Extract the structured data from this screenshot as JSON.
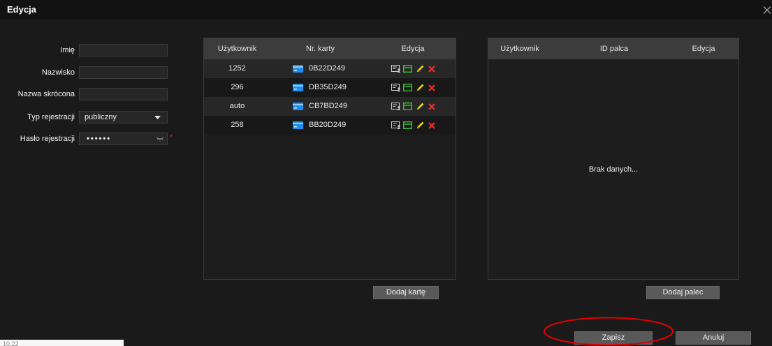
{
  "dialog": {
    "title": "Edycja"
  },
  "form": {
    "fields": [
      {
        "label": "Imię",
        "value": ""
      },
      {
        "label": "Nazwisko",
        "value": ""
      },
      {
        "label": "Nazwa skrócona",
        "value": ""
      },
      {
        "label": "Typ rejestracji",
        "value": "publiczny"
      },
      {
        "label": "Hasło rejestracji",
        "value": "••••••"
      }
    ],
    "required_mark": "*"
  },
  "cards_table": {
    "headers": [
      "Użytkownik",
      "Nr. karty",
      "Edycja"
    ],
    "rows": [
      {
        "user": "1252",
        "card": "0B22D249"
      },
      {
        "user": "296",
        "card": "DB35D249"
      },
      {
        "user": "auto",
        "card": "CB7BD249"
      },
      {
        "user": "258",
        "card": "BB20D249"
      }
    ],
    "add_button": "Dodaj kartę"
  },
  "fingerprint_table": {
    "headers": [
      "Użytkownik",
      "ID palca",
      "Edycja"
    ],
    "empty_text": "Brak danych...",
    "add_button": "Dodaj palec"
  },
  "footer": {
    "save_label": "Zapisz",
    "cancel_label": "Anuluj"
  },
  "status_strip": {
    "text": "10.22"
  },
  "icons": {
    "close": "close-icon",
    "select_arrow": "chevron-down-icon",
    "password_toggle": "eye-closed-icon",
    "card": "card-icon",
    "row_actions": [
      "card-info-icon",
      "card-status-icon",
      "pencil-icon",
      "delete-icon"
    ]
  },
  "colors": {
    "background": "#1a1a1a",
    "table_header": "#3c3c3c",
    "button": "#595959",
    "card_blue": "#1f8ef1",
    "action_green": "#3cc13c",
    "edit_yellow": "#f2e100",
    "delete_red": "#ff2a2a",
    "required_red": "#e02020",
    "annotation_red": "#e00000"
  }
}
